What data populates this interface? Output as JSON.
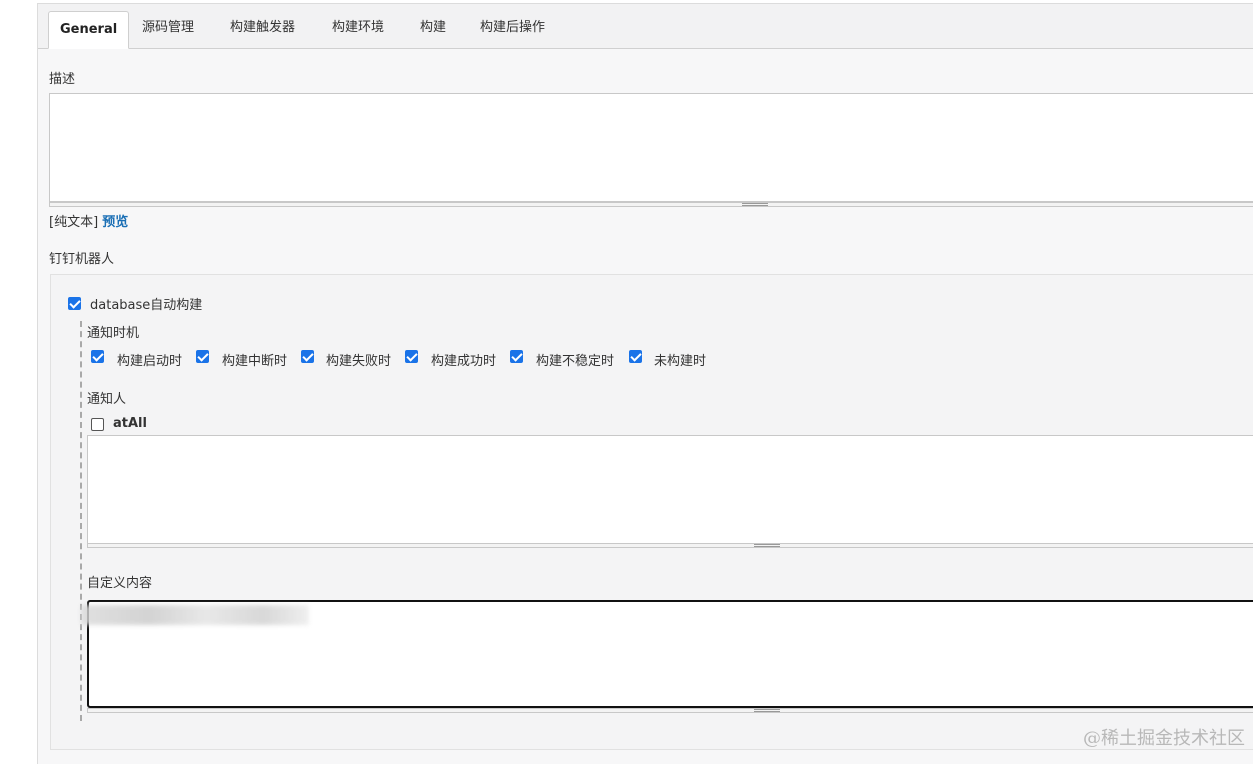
{
  "tabs": [
    {
      "label": "General",
      "active": true
    },
    {
      "label": "源码管理",
      "active": false
    },
    {
      "label": "构建触发器",
      "active": false
    },
    {
      "label": "构建环境",
      "active": false
    },
    {
      "label": "构建",
      "active": false
    },
    {
      "label": "构建后操作",
      "active": false
    }
  ],
  "description": {
    "label": "描述",
    "value": "",
    "plain_text": "[纯文本]",
    "preview_link": "预览"
  },
  "dingtalk": {
    "section_label": "钉钉机器人",
    "robot": {
      "label": "database自动构建",
      "checked": true
    },
    "notify_timing": {
      "label": "通知时机",
      "options": [
        {
          "label": "构建启动时",
          "checked": true
        },
        {
          "label": "构建中断时",
          "checked": true
        },
        {
          "label": "构建失败时",
          "checked": true
        },
        {
          "label": "构建成功时",
          "checked": true
        },
        {
          "label": "构建不稳定时",
          "checked": true
        },
        {
          "label": "未构建时",
          "checked": true
        }
      ]
    },
    "notify_people": {
      "label": "通知人",
      "at_all": {
        "label": "atAll",
        "checked": false
      },
      "value": ""
    },
    "custom_content": {
      "label": "自定义内容",
      "value": ""
    }
  },
  "watermark": "@稀土掘金技术社区",
  "colors": {
    "accent": "#1a73e8",
    "link": "#1a6fb5",
    "panel_bg": "#f7f7f8"
  }
}
